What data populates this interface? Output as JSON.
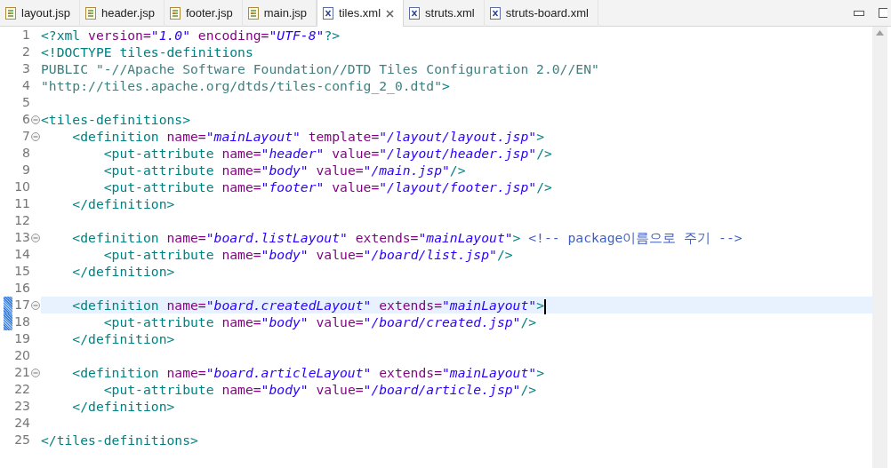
{
  "tabs": [
    {
      "label": "layout.jsp",
      "kind": "jsp",
      "selected": false
    },
    {
      "label": "header.jsp",
      "kind": "jsp",
      "selected": false
    },
    {
      "label": "footer.jsp",
      "kind": "jsp",
      "selected": false
    },
    {
      "label": "main.jsp",
      "kind": "jsp",
      "selected": false
    },
    {
      "label": "tiles.xml",
      "kind": "xml",
      "selected": true
    },
    {
      "label": "struts.xml",
      "kind": "xml",
      "selected": false
    },
    {
      "label": "struts-board.xml",
      "kind": "xml",
      "selected": false
    }
  ],
  "editor": {
    "lines": [
      {
        "number": "1",
        "foldable": false,
        "current": false,
        "changed": false,
        "tokens": [
          {
            "kind": "tag",
            "text": "<?xml"
          },
          {
            "kind": "attr",
            "text": " version="
          },
          {
            "kind": "string",
            "text": "\"1.0\""
          },
          {
            "kind": "attr",
            "text": " encoding="
          },
          {
            "kind": "string",
            "text": "\"UTF-8\""
          },
          {
            "kind": "tag",
            "text": "?>"
          }
        ]
      },
      {
        "number": "2",
        "foldable": false,
        "current": false,
        "changed": false,
        "tokens": [
          {
            "kind": "tag",
            "text": "<!DOCTYPE tiles-definitions"
          }
        ]
      },
      {
        "number": "3",
        "foldable": false,
        "current": false,
        "changed": false,
        "tokens": [
          {
            "kind": "doctype",
            "text": "PUBLIC \"-//Apache Software Foundation//DTD Tiles Configuration 2.0//EN\""
          }
        ]
      },
      {
        "number": "4",
        "foldable": false,
        "current": false,
        "changed": false,
        "tokens": [
          {
            "kind": "doctype",
            "text": "\"http://tiles.apache.org/dtds/tiles-config_2_0.dtd\""
          },
          {
            "kind": "tag",
            "text": ">"
          }
        ]
      },
      {
        "number": "5",
        "foldable": false,
        "current": false,
        "changed": false
      },
      {
        "number": "6",
        "foldable": true,
        "current": false,
        "changed": false,
        "tokens": [
          {
            "kind": "tag",
            "text": "<tiles-definitions>"
          }
        ]
      },
      {
        "number": "7",
        "foldable": true,
        "current": false,
        "changed": false,
        "tokens": [
          {
            "kind": "tag",
            "text": "    <definition"
          },
          {
            "kind": "attr",
            "text": " name="
          },
          {
            "kind": "string",
            "text": "\"mainLayout\""
          },
          {
            "kind": "attr",
            "text": " template="
          },
          {
            "kind": "string",
            "text": "\"/layout/layout.jsp\""
          },
          {
            "kind": "tag",
            "text": ">"
          }
        ]
      },
      {
        "number": "8",
        "foldable": false,
        "current": false,
        "changed": false,
        "tokens": [
          {
            "kind": "tag",
            "text": "        <put-attribute"
          },
          {
            "kind": "attr",
            "text": " name="
          },
          {
            "kind": "string",
            "text": "\"header\""
          },
          {
            "kind": "attr",
            "text": " value="
          },
          {
            "kind": "string",
            "text": "\"/layout/header.jsp\""
          },
          {
            "kind": "tag",
            "text": "/>"
          }
        ]
      },
      {
        "number": "9",
        "foldable": false,
        "current": false,
        "changed": false,
        "tokens": [
          {
            "kind": "tag",
            "text": "        <put-attribute"
          },
          {
            "kind": "attr",
            "text": " name="
          },
          {
            "kind": "string",
            "text": "\"body\""
          },
          {
            "kind": "attr",
            "text": " value="
          },
          {
            "kind": "string",
            "text": "\"/main.jsp\""
          },
          {
            "kind": "tag",
            "text": "/>"
          }
        ]
      },
      {
        "number": "10",
        "foldable": false,
        "current": false,
        "changed": false,
        "tokens": [
          {
            "kind": "tag",
            "text": "        <put-attribute"
          },
          {
            "kind": "attr",
            "text": " name="
          },
          {
            "kind": "string",
            "text": "\"footer\""
          },
          {
            "kind": "attr",
            "text": " value="
          },
          {
            "kind": "string",
            "text": "\"/layout/footer.jsp\""
          },
          {
            "kind": "tag",
            "text": "/>"
          }
        ]
      },
      {
        "number": "11",
        "foldable": false,
        "current": false,
        "changed": false,
        "tokens": [
          {
            "kind": "tag",
            "text": "    </definition>"
          }
        ]
      },
      {
        "number": "12",
        "foldable": false,
        "current": false,
        "changed": false
      },
      {
        "number": "13",
        "foldable": true,
        "current": false,
        "changed": false,
        "tokens": [
          {
            "kind": "tag",
            "text": "    <definition"
          },
          {
            "kind": "attr",
            "text": " name="
          },
          {
            "kind": "string",
            "text": "\"board.listLayout\""
          },
          {
            "kind": "attr",
            "text": " extends="
          },
          {
            "kind": "string",
            "text": "\"mainLayout\""
          },
          {
            "kind": "tag",
            "text": ">"
          },
          {
            "kind": "comment",
            "text": " <!-- package이름으로 주기 -->"
          }
        ]
      },
      {
        "number": "14",
        "foldable": false,
        "current": false,
        "changed": false,
        "tokens": [
          {
            "kind": "tag",
            "text": "        <put-attribute"
          },
          {
            "kind": "attr",
            "text": " name="
          },
          {
            "kind": "string",
            "text": "\"body\""
          },
          {
            "kind": "attr",
            "text": " value="
          },
          {
            "kind": "string",
            "text": "\"/board/list.jsp\""
          },
          {
            "kind": "tag",
            "text": "/>"
          }
        ]
      },
      {
        "number": "15",
        "foldable": false,
        "current": false,
        "changed": false,
        "tokens": [
          {
            "kind": "tag",
            "text": "    </definition>"
          }
        ]
      },
      {
        "number": "16",
        "foldable": false,
        "current": false,
        "changed": false
      },
      {
        "number": "17",
        "foldable": true,
        "current": true,
        "changed": true,
        "tokens": [
          {
            "kind": "tag",
            "text": "    <definition"
          },
          {
            "kind": "attr",
            "text": " name="
          },
          {
            "kind": "string",
            "text": "\"board.createdLayout\""
          },
          {
            "kind": "attr",
            "text": " extends="
          },
          {
            "kind": "string",
            "text": "\"mainLayout\""
          },
          {
            "kind": "tag",
            "text": ">"
          }
        ]
      },
      {
        "number": "18",
        "foldable": false,
        "current": false,
        "changed": true,
        "tokens": [
          {
            "kind": "tag",
            "text": "        <put-attribute"
          },
          {
            "kind": "attr",
            "text": " name="
          },
          {
            "kind": "string",
            "text": "\"body\""
          },
          {
            "kind": "attr",
            "text": " value="
          },
          {
            "kind": "string",
            "text": "\"/board/created.jsp\""
          },
          {
            "kind": "tag",
            "text": "/>"
          }
        ]
      },
      {
        "number": "19",
        "foldable": false,
        "current": false,
        "changed": false,
        "tokens": [
          {
            "kind": "tag",
            "text": "    </definition>"
          }
        ]
      },
      {
        "number": "20",
        "foldable": false,
        "current": false,
        "changed": false
      },
      {
        "number": "21",
        "foldable": true,
        "current": false,
        "changed": false,
        "tokens": [
          {
            "kind": "tag",
            "text": "    <definition"
          },
          {
            "kind": "attr",
            "text": " name="
          },
          {
            "kind": "string",
            "text": "\"board.articleLayout\""
          },
          {
            "kind": "attr",
            "text": " extends="
          },
          {
            "kind": "string",
            "text": "\"mainLayout\""
          },
          {
            "kind": "tag",
            "text": ">"
          }
        ]
      },
      {
        "number": "22",
        "foldable": false,
        "current": false,
        "changed": false,
        "tokens": [
          {
            "kind": "tag",
            "text": "        <put-attribute"
          },
          {
            "kind": "attr",
            "text": " name="
          },
          {
            "kind": "string",
            "text": "\"body\""
          },
          {
            "kind": "attr",
            "text": " value="
          },
          {
            "kind": "string",
            "text": "\"/board/article.jsp\""
          },
          {
            "kind": "tag",
            "text": "/>"
          }
        ]
      },
      {
        "number": "23",
        "foldable": false,
        "current": false,
        "changed": false,
        "tokens": [
          {
            "kind": "tag",
            "text": "    </definition>"
          }
        ]
      },
      {
        "number": "24",
        "foldable": false,
        "current": false,
        "changed": false
      },
      {
        "number": "25",
        "foldable": false,
        "current": false,
        "changed": false,
        "tokens": [
          {
            "kind": "tag",
            "text": "</tiles-definitions>"
          }
        ]
      }
    ]
  }
}
